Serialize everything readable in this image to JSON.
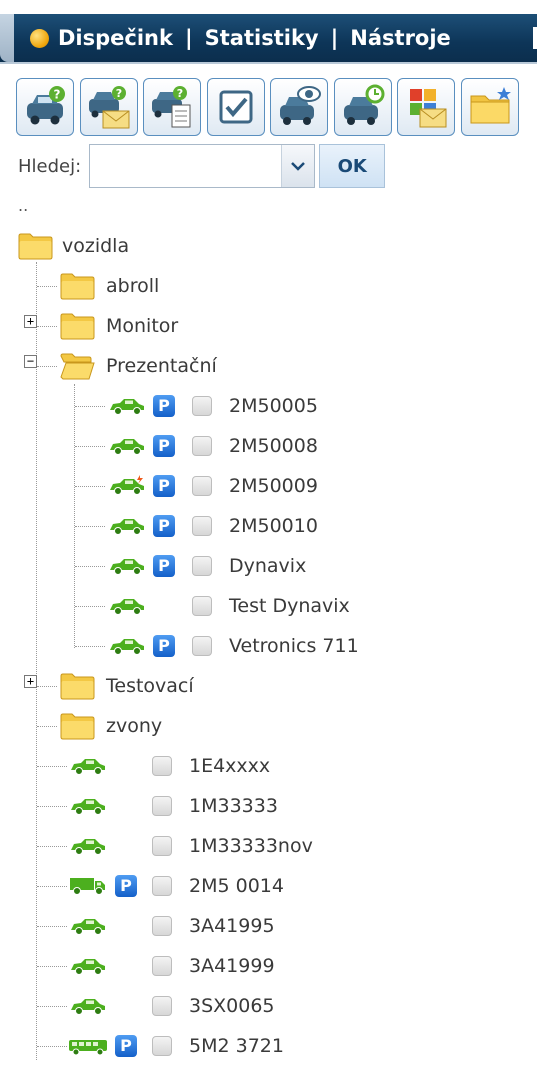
{
  "nav": {
    "items": [
      "Dispečink",
      "Statistiky",
      "Nástroje"
    ],
    "separator": "|",
    "status_color": "#f0a60c"
  },
  "toolbar": {
    "buttons": [
      {
        "icon": "vehicle-query-icon"
      },
      {
        "icon": "vehicle-mail-query-icon"
      },
      {
        "icon": "vehicle-document-query-icon"
      },
      {
        "icon": "checkbox-select-icon"
      },
      {
        "icon": "vehicle-watch-icon"
      },
      {
        "icon": "vehicle-time-query-icon"
      },
      {
        "icon": "contact-mail-icon"
      },
      {
        "icon": "new-folder-icon"
      }
    ]
  },
  "search": {
    "label": "Hledej:",
    "value": "",
    "placeholder": "",
    "ok_label": "OK"
  },
  "tree": {
    "parent_link": "..",
    "root": "vozidla",
    "folders": {
      "abroll": "abroll",
      "monitor": "Monitor",
      "prezentacni": "Prezentační",
      "testovaci": "Testovací",
      "zvony": "zvony"
    },
    "prezentacni_vehicles": [
      {
        "name": "2M50005",
        "icon": "car-icon",
        "parked": true
      },
      {
        "name": "2M50008",
        "icon": "car-icon",
        "parked": true
      },
      {
        "name": "2M50009",
        "icon": "car-alert-icon",
        "parked": true
      },
      {
        "name": "2M50010",
        "icon": "car-icon",
        "parked": true
      },
      {
        "name": "Dynavix",
        "icon": "car-icon",
        "parked": true
      },
      {
        "name": "Test Dynavix",
        "icon": "car-icon",
        "parked": false
      },
      {
        "name": "Vetronics 711",
        "icon": "car-icon",
        "parked": true
      }
    ],
    "zvony_vehicles": [
      {
        "name": "1E4xxxx",
        "icon": "car-icon",
        "parked": false
      },
      {
        "name": "1M33333",
        "icon": "car-icon",
        "parked": false
      },
      {
        "name": "1M33333nov",
        "icon": "car-icon",
        "parked": false
      },
      {
        "name": "2M5 0014",
        "icon": "truck-icon",
        "parked": true
      },
      {
        "name": "3A41995",
        "icon": "car-icon",
        "parked": false
      },
      {
        "name": "3A41999",
        "icon": "car-icon",
        "parked": false
      },
      {
        "name": "3SX0065",
        "icon": "car-icon",
        "parked": false
      },
      {
        "name": "5M2 3721",
        "icon": "bus-icon",
        "parked": true
      }
    ]
  },
  "colors": {
    "nav_bg": "#0d3558",
    "vehicle_green": "#4caf1e",
    "parking_blue": "#1f6fd6"
  }
}
